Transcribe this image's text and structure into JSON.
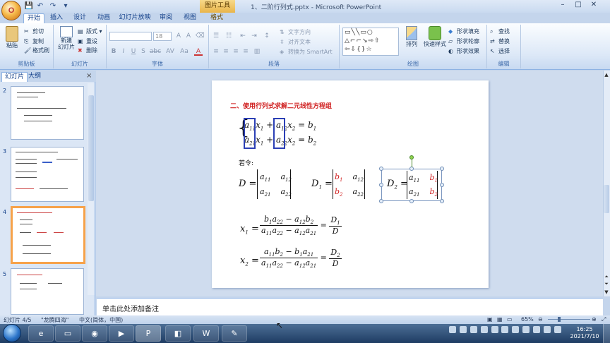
{
  "titlebar": {
    "office_button": "O",
    "picture_tools": "图片工具",
    "document_title": "1、二阶行列式.pptx - Microsoft PowerPoint",
    "window_controls": [
      "–",
      "□",
      "✕"
    ]
  },
  "tabs": [
    "开始",
    "插入",
    "设计",
    "动画",
    "幻灯片放映",
    "审阅",
    "视图",
    "格式"
  ],
  "ribbon": {
    "clipboard": {
      "label": "剪贴板",
      "paste": "粘贴",
      "cut": "剪切",
      "copy": "复制",
      "format_painter": "格式刷"
    },
    "slides": {
      "label": "幻灯片",
      "new_slide": "新建\n幻灯片",
      "layout": "版式",
      "reset": "重设",
      "delete": "删除"
    },
    "font": {
      "label": "字体",
      "font_size": "18",
      "buttons": [
        "B",
        "I",
        "U",
        "S",
        "abc",
        "AV",
        "Aa",
        "A"
      ]
    },
    "paragraph": {
      "label": "段落",
      "text_direction": "文字方向",
      "align_text": "对齐文本",
      "convert_smartart": "转换为 SmartArt"
    },
    "drawing": {
      "label": "绘图",
      "arrange": "排列",
      "quick_styles": "快速样式",
      "shape_fill": "形状填充",
      "shape_outline": "形状轮廓",
      "shape_effects": "形状效果"
    },
    "editing": {
      "label": "编辑",
      "find": "查找",
      "replace": "替换",
      "select": "选择"
    }
  },
  "left_panel": {
    "tab_slides": "幻灯片",
    "tab_outline": "大纲",
    "close": "×",
    "thumb_numbers": [
      "2",
      "3",
      "4",
      "5"
    ]
  },
  "slide": {
    "title": "二、使用行列式求解二元线性方程组",
    "let_label": "若令:",
    "D_label": "D =",
    "D1_label": "D",
    "D2_label": "D",
    "x1_label": "x",
    "x2_label": "x"
  },
  "notes": {
    "placeholder": "单击此处添加备注"
  },
  "statusbar": {
    "slide_info": "幻灯片 4/5",
    "theme": "\"龙腾四海\"",
    "language": "中文(简体，中国)",
    "zoom": "65%"
  },
  "taskbar": {
    "time": "16:25",
    "date": "2021/7/10"
  }
}
